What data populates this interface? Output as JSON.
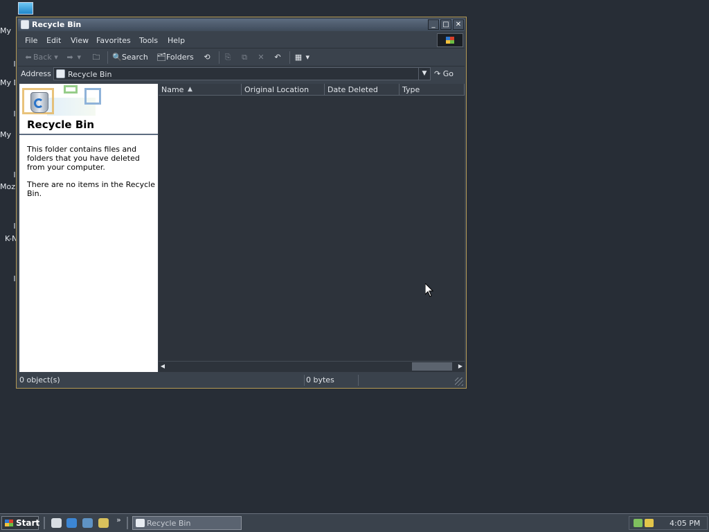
{
  "desktop": {
    "icons": [
      {
        "label": "My"
      },
      {
        "label": "My D"
      },
      {
        "label": "My"
      },
      {
        "label": "Moz"
      },
      {
        "label": "K-N"
      }
    ]
  },
  "window": {
    "title": "Recycle Bin",
    "controls": {
      "minimize": "_",
      "maximize": "□",
      "close": "✕"
    },
    "menu": [
      "File",
      "Edit",
      "View",
      "Favorites",
      "Tools",
      "Help"
    ],
    "toolbar": {
      "back": "Back",
      "forward": "",
      "search": "Search",
      "folders": "Folders"
    },
    "address": {
      "label": "Address",
      "value": "Recycle Bin",
      "go": "Go"
    },
    "taskpane": {
      "title": "Recycle Bin",
      "description": "This folder contains files and folders that you have deleted from your computer.",
      "empty_message": "There are no items in the Recycle Bin."
    },
    "list": {
      "columns": [
        "Name",
        "Original Location",
        "Date Deleted",
        "Type"
      ]
    },
    "status": {
      "objects": "0 object(s)",
      "size": "0 bytes"
    }
  },
  "taskbar": {
    "start_label": "Start",
    "more": "»",
    "task": "Recycle Bin",
    "clock": "4:05 PM"
  }
}
